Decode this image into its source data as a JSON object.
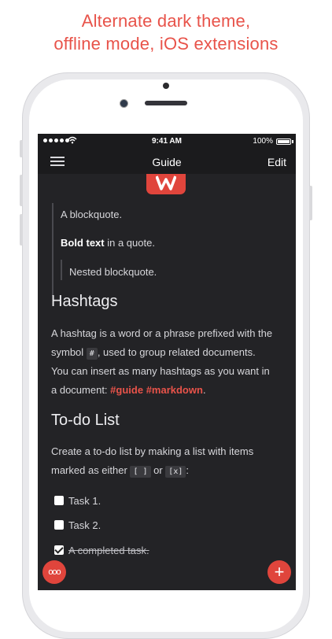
{
  "headline": {
    "line1": "Alternate dark theme,",
    "line2": "offline mode, iOS extensions"
  },
  "status_bar": {
    "time": "9:41 AM",
    "battery": "100%"
  },
  "nav": {
    "title": "Guide",
    "edit_label": "Edit"
  },
  "blockquote": {
    "line1": "A blockquote.",
    "bold": "Bold text",
    "bold_rest": " in a quote.",
    "nested": "Nested blockquote."
  },
  "hashtags": {
    "heading": "Hashtags",
    "p1": "A hashtag is a word or a phrase prefixed with the",
    "p2a": "symbol ",
    "p2_code": "#",
    "p2b": ", used to group related documents.",
    "p3": "You can insert as many hashtags as you want in",
    "p4a": "a document: ",
    "tag1": "#guide",
    "tag2": "#markdown",
    "p4b": "."
  },
  "todo": {
    "heading": "To-do List",
    "p1": "Create a to-do list by making a list with items",
    "p2a": "marked as either ",
    "code1": "[ ]",
    "p2b": " or ",
    "code2": "[x]",
    "p2c": ":",
    "items": [
      {
        "label": "Task 1.",
        "checked": false
      },
      {
        "label": "Task 2.",
        "checked": false
      },
      {
        "label": "A completed task.",
        "checked": true
      }
    ]
  },
  "fab": {
    "more_icon": "ooo",
    "add_icon": "+"
  },
  "colors": {
    "accent": "#e8534a",
    "screen_bg": "#232326",
    "bar_bg": "#1b1b1d"
  }
}
